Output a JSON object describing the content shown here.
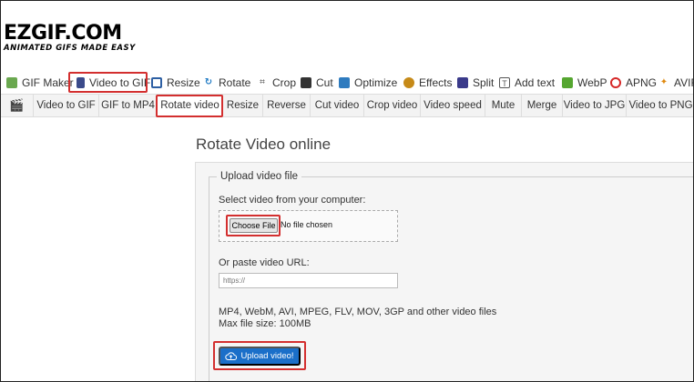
{
  "logo": {
    "text": "EZGIF.COM",
    "tagline": "ANIMATED GIFS MADE EASY"
  },
  "main_nav": [
    {
      "label": "GIF Maker",
      "icon": "image-icon",
      "color": "#3d7a2f"
    },
    {
      "label": "Video to GIF",
      "icon": "film-icon",
      "color": "#3b4a8a"
    },
    {
      "label": "Resize",
      "icon": "resize-icon",
      "color": "#2d5fa3"
    },
    {
      "label": "Rotate",
      "icon": "rotate-icon",
      "color": "#1f7ac4"
    },
    {
      "label": "Crop",
      "icon": "crop-icon",
      "color": "#444444"
    },
    {
      "label": "Cut",
      "icon": "cut-icon",
      "color": "#333333"
    },
    {
      "label": "Optimize",
      "icon": "optimize-icon",
      "color": "#2e7bbf"
    },
    {
      "label": "Effects",
      "icon": "effects-icon",
      "color": "#c68a18"
    },
    {
      "label": "Split",
      "icon": "split-icon",
      "color": "#3a3a8a"
    },
    {
      "label": "Add text",
      "icon": "text-icon",
      "color": "#555555"
    },
    {
      "label": "WebP",
      "icon": "webp-icon",
      "color": "#55a630"
    },
    {
      "label": "APNG",
      "icon": "apng-icon",
      "color": "#d62828"
    },
    {
      "label": "AVIF",
      "icon": "avif-icon",
      "color": "#e08a10"
    }
  ],
  "sub_nav": [
    "Video to GIF",
    "GIF to MP4",
    "Rotate video",
    "Resize",
    "Reverse",
    "Cut video",
    "Crop video",
    "Video speed",
    "Mute",
    "Merge",
    "Video to JPG",
    "Video to PNG"
  ],
  "page_title": "Rotate Video online",
  "form": {
    "legend": "Upload video file",
    "select_label": "Select video from your computer:",
    "choose_file_label": "Choose File",
    "no_file_text": "No file chosen",
    "url_label": "Or paste video URL:",
    "url_placeholder": "https://",
    "formats_text": "MP4, WebM, AVI, MPEG, FLV, MOV, 3GP and other video files",
    "max_size_text": "Max file size: 100MB",
    "upload_label": "Upload video!"
  },
  "colors": {
    "highlight": "#d32f2f",
    "upload_button": "#1a6fc9"
  }
}
